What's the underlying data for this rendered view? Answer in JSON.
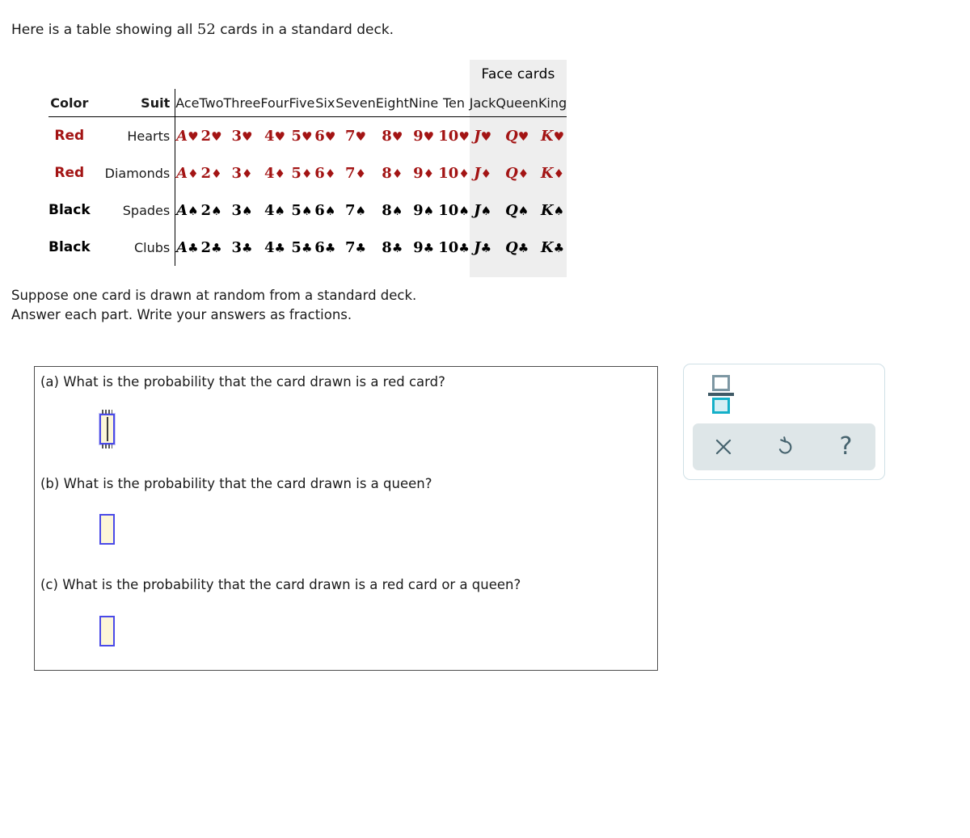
{
  "intro": {
    "before": "Here is a table showing all ",
    "count": "52",
    "after": " cards in a standard deck."
  },
  "table": {
    "facecards_label": "Face cards",
    "col_color": "Color",
    "col_suit": "Suit",
    "rank_headers": [
      "Ace",
      "Two",
      "Three",
      "Four",
      "Five",
      "Six",
      "Seven",
      "Eight",
      "Nine",
      "Ten"
    ],
    "face_headers": [
      "Jack",
      "Queen",
      "King"
    ],
    "rows": [
      {
        "color": "Red",
        "suit": "Hearts",
        "pip": "♥",
        "ink": "#a31414",
        "ranks": [
          "A",
          "2",
          "3",
          "4",
          "5",
          "6",
          "7",
          "8",
          "9",
          "10"
        ],
        "faces": [
          "J",
          "Q",
          "K"
        ]
      },
      {
        "color": "Red",
        "suit": "Diamonds",
        "pip": "♦",
        "ink": "#a31414",
        "ranks": [
          "A",
          "2",
          "3",
          "4",
          "5",
          "6",
          "7",
          "8",
          "9",
          "10"
        ],
        "faces": [
          "J",
          "Q",
          "K"
        ]
      },
      {
        "color": "Black",
        "suit": "Spades",
        "pip": "♠",
        "ink": "#000000",
        "ranks": [
          "A",
          "2",
          "3",
          "4",
          "5",
          "6",
          "7",
          "8",
          "9",
          "10"
        ],
        "faces": [
          "J",
          "Q",
          "K"
        ]
      },
      {
        "color": "Black",
        "suit": "Clubs",
        "pip": "♣",
        "ink": "#000000",
        "ranks": [
          "A",
          "2",
          "3",
          "4",
          "5",
          "6",
          "7",
          "8",
          "9",
          "10"
        ],
        "faces": [
          "J",
          "Q",
          "K"
        ]
      }
    ]
  },
  "prompt": "Suppose one card is drawn at random from a standard deck.\nAnswer each part. Write your answers as fractions.",
  "questions": [
    {
      "label": "(a) What is the probability that the card drawn is a red card?",
      "answer": "",
      "focused": true
    },
    {
      "label": "(b) What is the probability that the card drawn is a queen?",
      "answer": "",
      "focused": false
    },
    {
      "label": "(c) What is the probability that the card drawn is a red card or a queen?",
      "answer": "",
      "focused": false
    }
  ],
  "mathpad": {
    "fraction_icon": "fraction-icon",
    "buttons": [
      {
        "name": "clear-button",
        "icon": "x-icon",
        "glyph": "✕"
      },
      {
        "name": "undo-button",
        "icon": "undo-icon",
        "glyph": "↺"
      },
      {
        "name": "help-button",
        "icon": "question-mark-icon",
        "glyph": "?"
      }
    ]
  },
  "colors": {
    "red_ink": "#a31414",
    "black_ink": "#000000",
    "face_band": "#eeeeee",
    "input_fill": "#fcf6d8",
    "input_border": "#4a4ae8",
    "pad_bg": "#dee6e8",
    "pad_ink": "#46636e",
    "teal": "#14b0c8"
  }
}
